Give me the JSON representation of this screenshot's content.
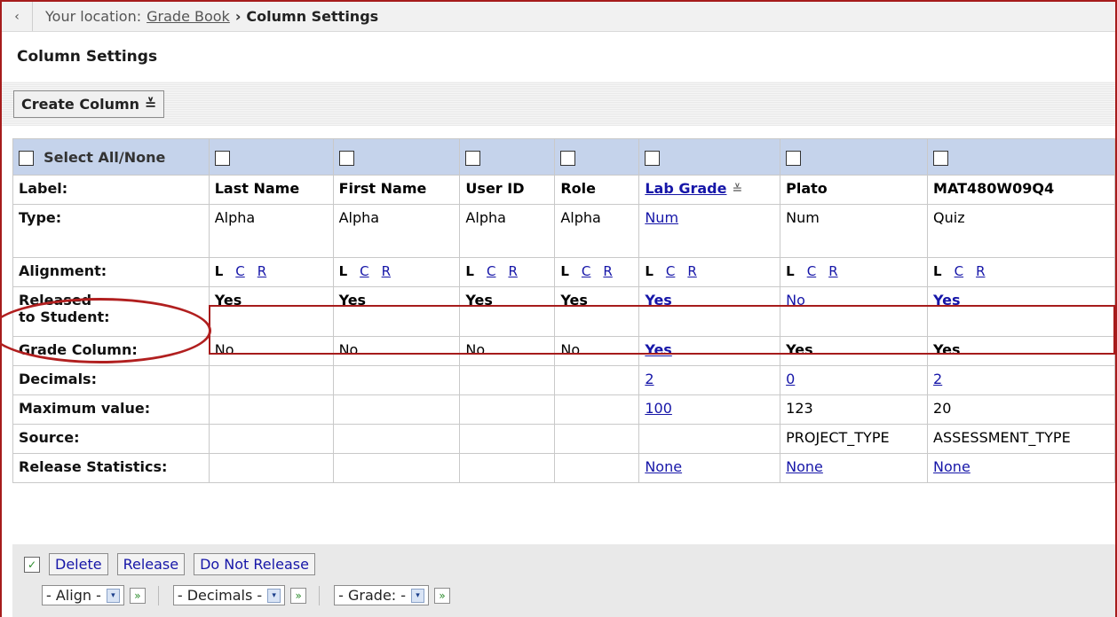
{
  "breadcrumb": {
    "back": "‹",
    "prefix": "Your location:",
    "link": "Grade Book",
    "separator": "›",
    "current": "Column Settings"
  },
  "page_title": "Column Settings",
  "toolbar": {
    "create_column": "Create Column"
  },
  "grid": {
    "select_all": "Select All/None",
    "row_labels": {
      "label": "Label:",
      "type": "Type:",
      "alignment": "Alignment:",
      "released_1": "Released",
      "released_2": "to Student:",
      "grade_column": "Grade Column:",
      "decimals": "Decimals:",
      "maximum_value": "Maximum value:",
      "source": "Source:",
      "release_statistics": "Release Statistics:"
    },
    "align_letters": {
      "l": "L",
      "c": "C",
      "r": "R"
    },
    "columns": [
      {
        "label": "Last Name",
        "type": "Alpha",
        "released": "Yes",
        "grade": "No",
        "decimals": "",
        "max": "",
        "source": "",
        "stats": ""
      },
      {
        "label": "First Name",
        "type": "Alpha",
        "released": "Yes",
        "grade": "No",
        "decimals": "",
        "max": "",
        "source": "",
        "stats": ""
      },
      {
        "label": "User ID",
        "type": "Alpha",
        "released": "Yes",
        "grade": "No",
        "decimals": "",
        "max": "",
        "source": "",
        "stats": ""
      },
      {
        "label": "Role",
        "type": "Alpha",
        "released": "Yes",
        "grade": "No",
        "decimals": "",
        "max": "",
        "source": "",
        "stats": ""
      },
      {
        "label": "Lab Grade",
        "type": "Num",
        "released": "Yes",
        "grade": "Yes",
        "decimals": "2",
        "max": "100",
        "source": "",
        "stats": "None"
      },
      {
        "label": "Plato",
        "type": "Num",
        "released": "No",
        "grade": "Yes",
        "decimals": "0",
        "max": "123",
        "source": "PROJECT_TYPE",
        "stats": "None"
      },
      {
        "label": "MAT480W09Q4",
        "type": "Quiz",
        "released": "Yes",
        "grade": "Yes",
        "decimals": "2",
        "max": "20",
        "source": "ASSESSMENT_TYPE",
        "stats": "None"
      }
    ]
  },
  "actions": {
    "delete": "Delete",
    "release": "Release",
    "do_not_release": "Do Not Release",
    "align": "- Align -",
    "decimals": "- Decimals -",
    "grade": "- Grade: -"
  },
  "icons": {
    "menu_glyph": "≚",
    "select_arrow": "▾",
    "go_glyph": "»",
    "check_glyph": "✓"
  },
  "colors": {
    "link": "#1616a8",
    "header_bg": "#c5d3eb",
    "annotation": "#a61c1c"
  }
}
